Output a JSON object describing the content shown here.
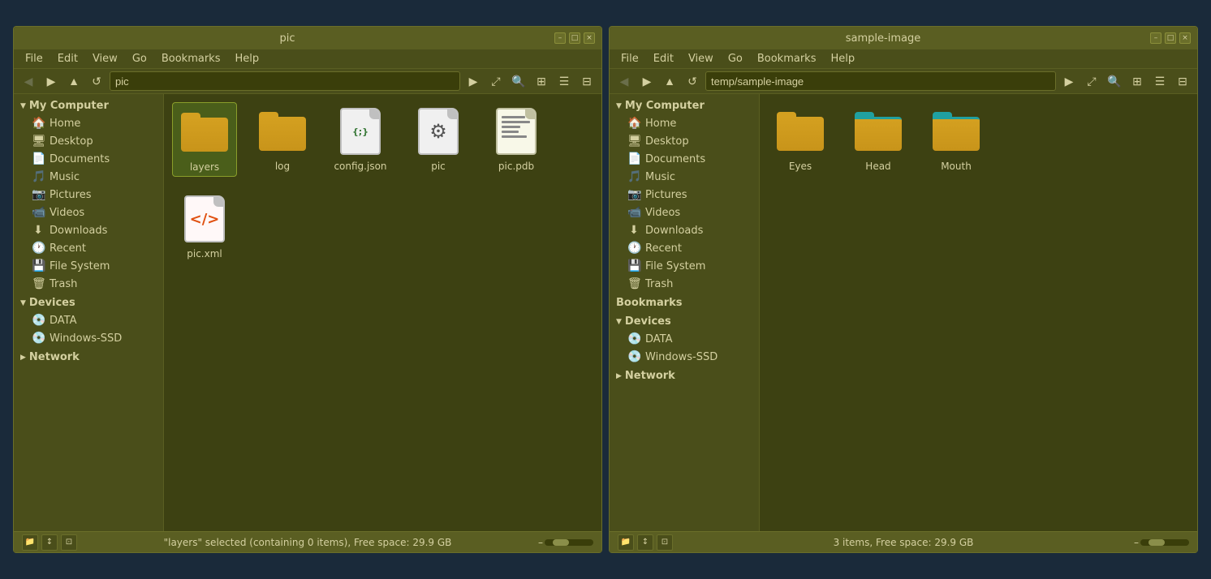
{
  "windows": [
    {
      "id": "left",
      "title": "pic",
      "address": "pic",
      "menubar": [
        "File",
        "Edit",
        "View",
        "Go",
        "Bookmarks",
        "Help"
      ],
      "sidebar": {
        "sections": [
          {
            "label": "My Computer",
            "expanded": true,
            "items": [
              {
                "label": "Home",
                "icon": "🏠",
                "active": false
              },
              {
                "label": "Desktop",
                "icon": "🖥",
                "active": false
              },
              {
                "label": "Documents",
                "icon": "📄",
                "active": false
              },
              {
                "label": "Music",
                "icon": "🎵",
                "active": false
              },
              {
                "label": "Pictures",
                "icon": "📷",
                "active": false
              },
              {
                "label": "Videos",
                "icon": "📹",
                "active": false
              },
              {
                "label": "Downloads",
                "icon": "⬇",
                "active": false
              },
              {
                "label": "Recent",
                "icon": "🕐",
                "active": false
              },
              {
                "label": "File System",
                "icon": "💾",
                "active": false
              },
              {
                "label": "Trash",
                "icon": "🗑",
                "active": false
              }
            ]
          },
          {
            "label": "Devices",
            "expanded": true,
            "items": [
              {
                "label": "DATA",
                "icon": "💿",
                "active": false
              },
              {
                "label": "Windows-SSD",
                "icon": "💿",
                "active": false
              }
            ]
          },
          {
            "label": "Network",
            "expanded": false,
            "items": []
          }
        ]
      },
      "files": [
        {
          "name": "layers",
          "type": "folder",
          "selected": true
        },
        {
          "name": "log",
          "type": "folder",
          "selected": false
        },
        {
          "name": "config.json",
          "type": "json",
          "selected": false
        },
        {
          "name": "pic",
          "type": "folder-gear",
          "selected": false
        },
        {
          "name": "pic.pdb",
          "type": "pdb",
          "selected": false
        },
        {
          "name": "pic.xml",
          "type": "xml",
          "selected": false
        }
      ],
      "statusbar": "\"layers\" selected (containing 0 items), Free space: 29.9 GB"
    },
    {
      "id": "right",
      "title": "sample-image",
      "address": "temp/sample-image",
      "menubar": [
        "File",
        "Edit",
        "View",
        "Go",
        "Bookmarks",
        "Help"
      ],
      "sidebar": {
        "sections": [
          {
            "label": "My Computer",
            "expanded": true,
            "items": [
              {
                "label": "Home",
                "icon": "🏠",
                "active": false
              },
              {
                "label": "Desktop",
                "icon": "🖥",
                "active": false
              },
              {
                "label": "Documents",
                "icon": "📄",
                "active": false
              },
              {
                "label": "Music",
                "icon": "🎵",
                "active": false
              },
              {
                "label": "Pictures",
                "icon": "📷",
                "active": false
              },
              {
                "label": "Videos",
                "icon": "📹",
                "active": false
              },
              {
                "label": "Downloads",
                "icon": "⬇",
                "active": false
              },
              {
                "label": "Recent",
                "icon": "🕐",
                "active": false
              },
              {
                "label": "File System",
                "icon": "💾",
                "active": false
              },
              {
                "label": "Trash",
                "icon": "🗑",
                "active": false
              }
            ]
          },
          {
            "label": "Bookmarks",
            "expanded": false,
            "items": []
          },
          {
            "label": "Devices",
            "expanded": true,
            "items": [
              {
                "label": "DATA",
                "icon": "💿",
                "active": false
              },
              {
                "label": "Windows-SSD",
                "icon": "💿",
                "active": false
              }
            ]
          },
          {
            "label": "Network",
            "expanded": false,
            "items": []
          }
        ]
      },
      "files": [
        {
          "name": "Eyes",
          "type": "folder",
          "selected": false
        },
        {
          "name": "Head",
          "type": "folder-teal",
          "selected": false
        },
        {
          "name": "Mouth",
          "type": "folder-teal",
          "selected": false
        }
      ],
      "statusbar": "3 items, Free space: 29.9 GB"
    }
  ],
  "icons": {
    "back": "◀",
    "forward": "▶",
    "up": "▲",
    "reload": "↺",
    "open_location": "⤢",
    "search": "🔍",
    "icon_view": "⊞",
    "list_view": "☰",
    "detail_view": "⊟",
    "chevron_right": "▶",
    "chevron_down": "▼",
    "minus": "–",
    "expand": "⤡"
  }
}
